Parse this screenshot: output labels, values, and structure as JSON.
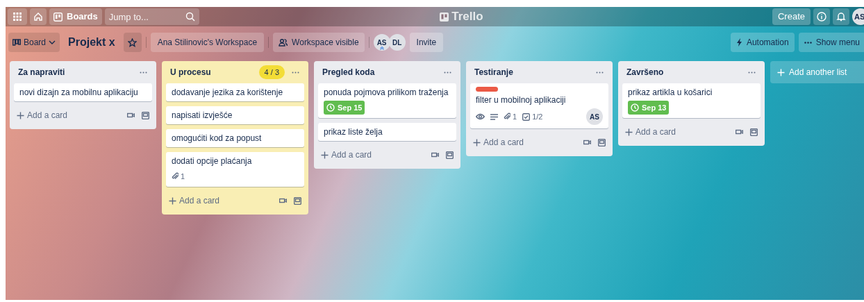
{
  "topbar": {
    "boards": "Boards",
    "search": {
      "placeholder": "Jump to..."
    },
    "logo": "Trello",
    "create": "Create",
    "avatar": "AS"
  },
  "board_header": {
    "view": "Board",
    "title": "Projekt x",
    "starred": false,
    "workspace": "Ana Stilinovic's Workspace",
    "visibility": "Workspace visible",
    "members": [
      {
        "initials": "AS",
        "admin": true
      },
      {
        "initials": "DL",
        "admin": false
      }
    ],
    "invite": "Invite",
    "automation": "Automation",
    "show_menu": "Show menu"
  },
  "lists": [
    {
      "title": "Za napraviti",
      "over_limit": false,
      "add_card": "Add a card",
      "cards": [
        {
          "title": "novi dizajn za mobilnu aplikaciju"
        }
      ]
    },
    {
      "title": "U procesu",
      "wip": "4 / 3",
      "over_limit": true,
      "add_card": "Add a card",
      "cards": [
        {
          "title": "dodavanje jezika za korištenje"
        },
        {
          "title": "napisati izvješće"
        },
        {
          "title": "omogućiti kod za popust"
        },
        {
          "title": "dodati opcije plaćanja",
          "attachments": "1"
        }
      ]
    },
    {
      "title": "Pregled koda",
      "over_limit": false,
      "add_card": "Add a card",
      "cards": [
        {
          "title": "ponuda pojmova prilikom traženja",
          "due": "Sep 15",
          "due_complete": true
        },
        {
          "title": "prikaz liste želja"
        }
      ]
    },
    {
      "title": "Testiranje",
      "over_limit": false,
      "add_card": "Add a card",
      "cards": [
        {
          "title": "filter u mobilnoj aplikaciji",
          "label": {
            "color": "#eb5a46"
          },
          "watching": true,
          "description": true,
          "attachments": "1",
          "checklist": "1/2",
          "members": [
            "AS"
          ]
        }
      ]
    },
    {
      "title": "Završeno",
      "over_limit": false,
      "add_card": "Add a card",
      "cards": [
        {
          "title": "prikaz artikla u košarici",
          "due": "Sep 13",
          "due_complete": true
        }
      ]
    }
  ],
  "add_list": "Add another list"
}
